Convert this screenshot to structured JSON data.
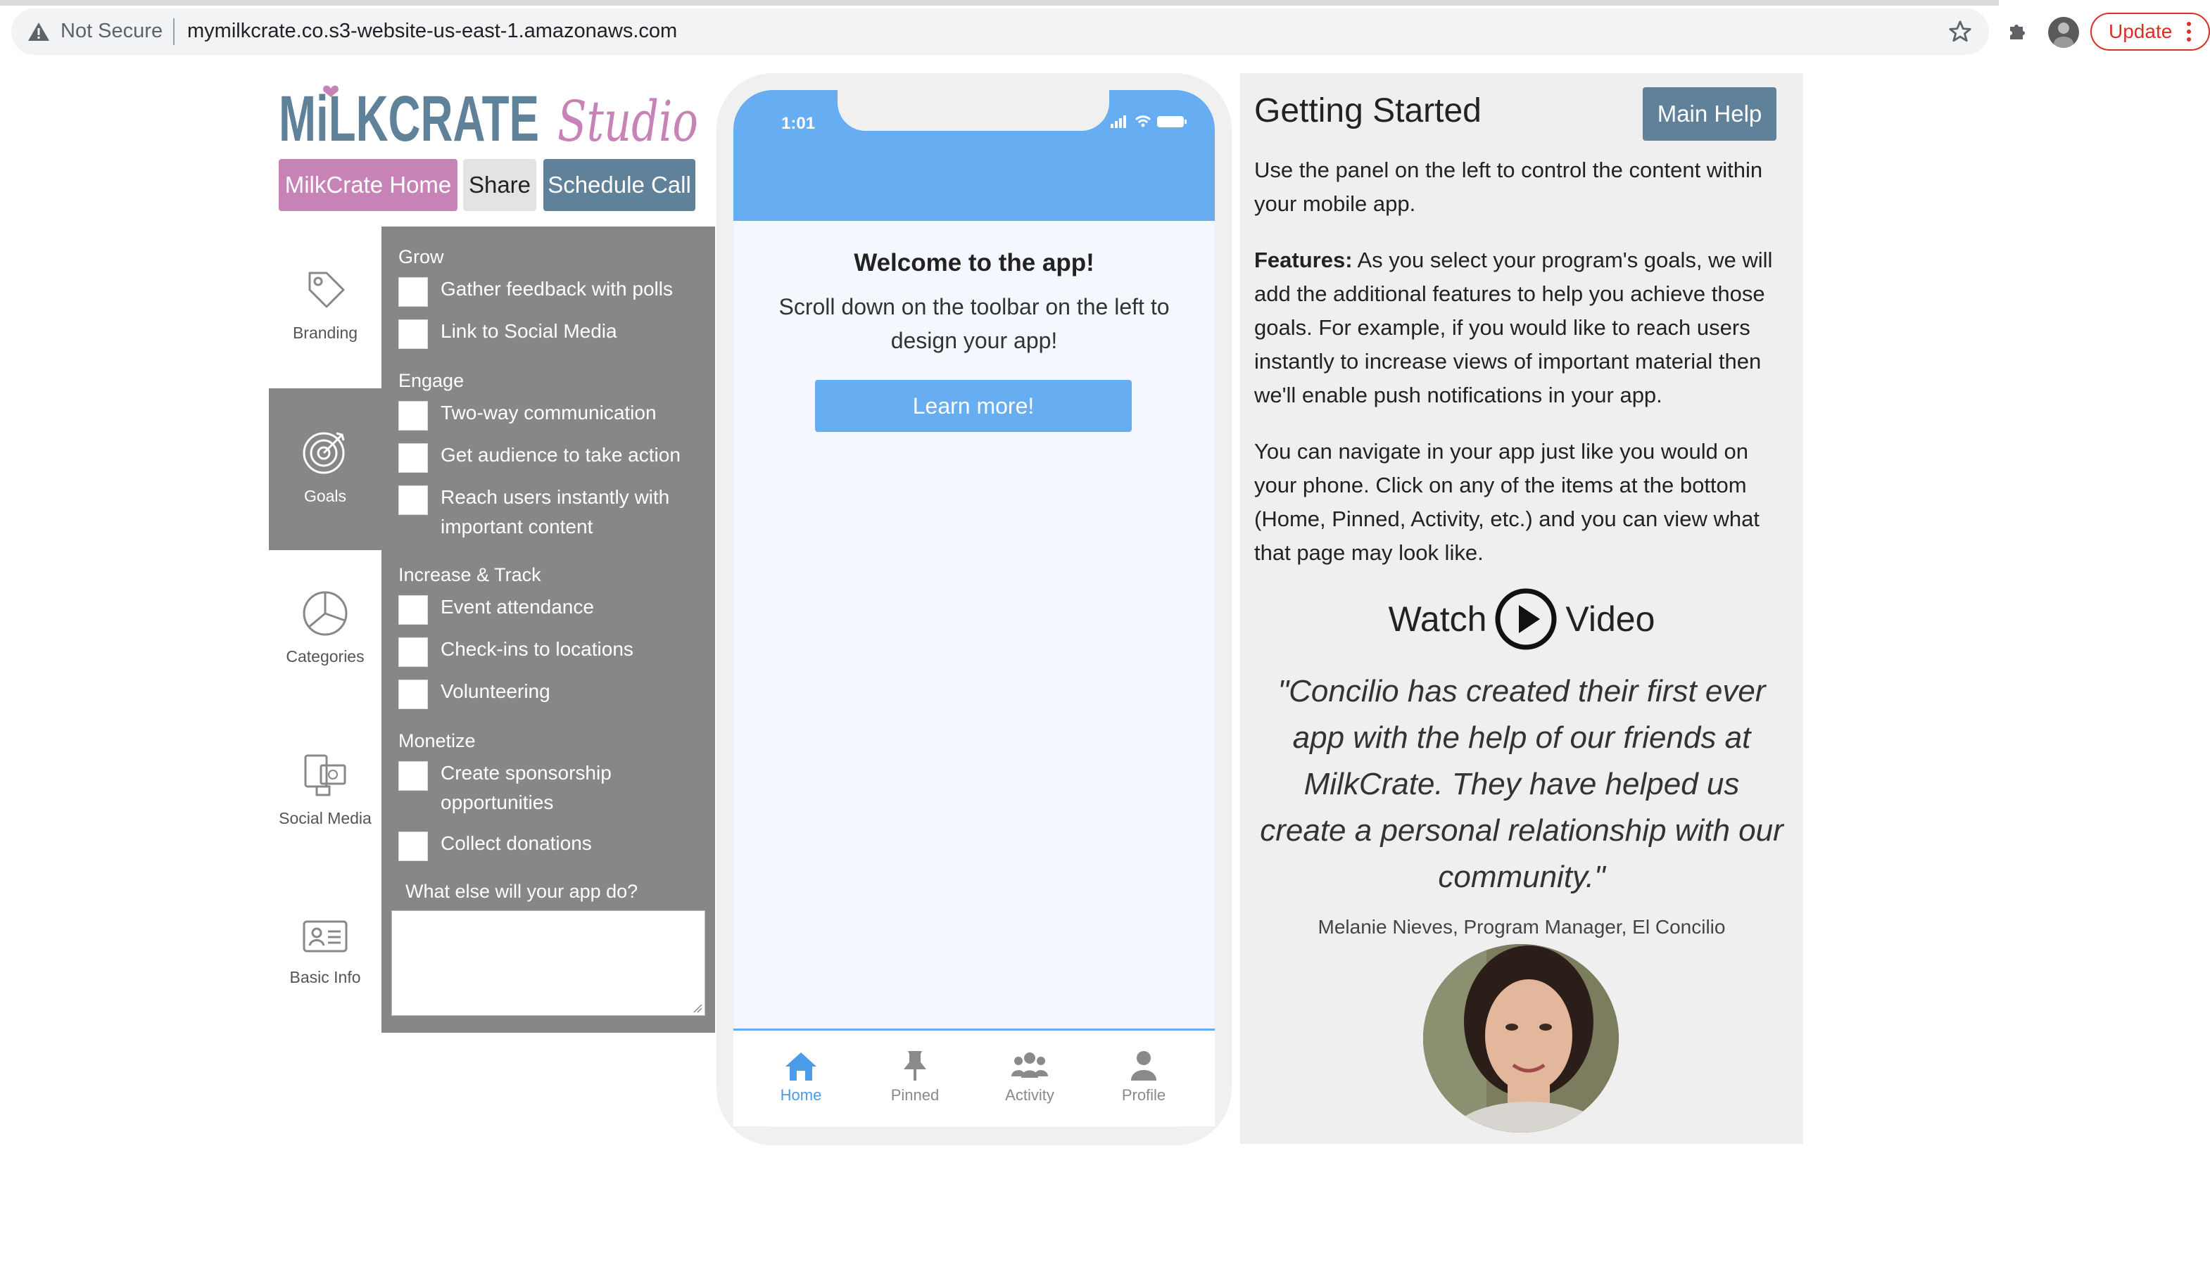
{
  "browser": {
    "security_label": "Not Secure",
    "url": "mymilkcrate.co.s3-website-us-east-1.amazonaws.com",
    "update_label": "Update"
  },
  "header": {
    "logo_main": "MiLKCRATE",
    "logo_sub": "Studio",
    "buttons": {
      "home": "MilkCrate Home",
      "share": "Share",
      "schedule": "Schedule Call"
    }
  },
  "sidebar_tabs": [
    {
      "label": "Branding",
      "icon": "tag-icon"
    },
    {
      "label": "Goals",
      "icon": "target-icon",
      "active": true
    },
    {
      "label": "Categories",
      "icon": "pie-chart-icon"
    },
    {
      "label": "Social Media",
      "icon": "social-media-icon"
    },
    {
      "label": "Basic Info",
      "icon": "id-card-icon"
    }
  ],
  "goals": {
    "groups": [
      {
        "title": "Grow",
        "items": [
          "Gather feedback with polls",
          "Link to Social Media"
        ]
      },
      {
        "title": "Engage",
        "items": [
          "Two-way communication",
          "Get audience to take action",
          "Reach users instantly with important content"
        ]
      },
      {
        "title": "Increase & Track",
        "items": [
          "Event attendance",
          "Check-ins to locations",
          "Volunteering"
        ]
      },
      {
        "title": "Monetize",
        "items": [
          "Create sponsorship opportunities",
          "Collect donations"
        ]
      }
    ],
    "question": "What else will your app do?",
    "textarea_value": ""
  },
  "phone": {
    "time": "1:01",
    "welcome_title": "Welcome to the app!",
    "welcome_text": "Scroll down on the toolbar on the left to design your app!",
    "learn_more": "Learn more!",
    "tabs": [
      {
        "label": "Home",
        "icon": "home-icon",
        "active": true
      },
      {
        "label": "Pinned",
        "icon": "pin-icon"
      },
      {
        "label": "Activity",
        "icon": "users-icon"
      },
      {
        "label": "Profile",
        "icon": "user-icon"
      }
    ]
  },
  "help": {
    "title": "Getting Started",
    "main_help": "Main Help",
    "intro": "Use the panel on the left to control the content within your mobile app.",
    "features_label": "Features:",
    "features_text": " As you select your program's goals, we will add the additional features to help you achieve those goals. For example, if you would like to reach users instantly to increase views of important material then we'll enable push notifications in your app.",
    "navigate_text": "You can navigate in your app just like you would on your phone. Click on any of the items at the bottom (Home, Pinned, Activity, etc.) and you can view what that page may look like.",
    "watch": "Watch",
    "video": "Video",
    "quote": "\"Concilio has created their first ever app with the help of our friends at MilkCrate. They have helped us create a personal relationship with our community.\"",
    "attribution": "Melanie Nieves, Program Manager, El Concilio"
  },
  "colors": {
    "pink": "#c883b6",
    "slate": "#5f8199",
    "panel_gray": "#878787",
    "phone_blue": "#67adf1"
  }
}
